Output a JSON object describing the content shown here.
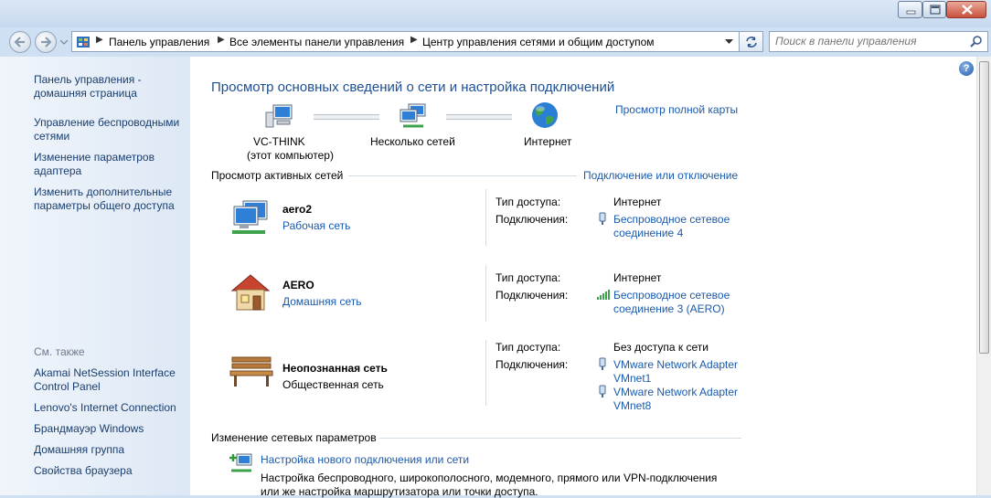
{
  "address": {
    "seg1": "Панель управления",
    "seg2": "Все элементы панели управления",
    "seg3": "Центр управления сетями и общим доступом",
    "separator": "▶"
  },
  "search": {
    "placeholder": "Поиск в панели управления"
  },
  "help_label": "?",
  "sidebar": {
    "items": [
      {
        "label": "Панель управления -\nдомашняя страница"
      },
      {
        "label": "Управление беспроводными\nсетями"
      },
      {
        "label": "Изменение параметров\nадаптера"
      },
      {
        "label": "Изменить дополнительные\nпараметры общего доступа"
      }
    ],
    "see_also": "См. также",
    "see_also_items": [
      {
        "label": "Akamai NetSession Interface\nControl Panel"
      },
      {
        "label": "Lenovo's Internet Connection"
      },
      {
        "label": "Брандмауэр Windows"
      },
      {
        "label": "Домашняя группа"
      },
      {
        "label": "Свойства браузера"
      }
    ]
  },
  "main": {
    "title": "Просмотр основных сведений о сети и настройка подключений",
    "full_map_link": "Просмотр полной карты",
    "map": {
      "computer": "VC-THINK",
      "computer_sub": "(этот компьютер)",
      "networks": "Несколько сетей",
      "internet": "Интернет"
    },
    "active_header": "Просмотр активных сетей",
    "connect_link": "Подключение или отключение",
    "labels": {
      "access": "Тип доступа:",
      "connections": "Подключения:"
    },
    "networks": [
      {
        "name": "aero2",
        "type": "Рабочая сеть",
        "access": "Интернет",
        "connection": "Беспроводное сетевое",
        "connection2": "соединение 4"
      },
      {
        "name": "AERO",
        "type": "Домашняя сеть",
        "access": "Интернет",
        "connection": "Беспроводное сетевое",
        "connection2": "соединение 3 (AERO)"
      },
      {
        "name": "Неопознанная сеть",
        "type": "Общественная сеть",
        "access": "Без доступа к сети",
        "connection": "VMware Network Adapter",
        "connection2": "VMnet1",
        "connection3": "VMware Network Adapter",
        "connection4": "VMnet8"
      }
    ],
    "change_header": "Изменение сетевых параметров",
    "tasks": [
      {
        "link": "Настройка нового подключения или сети",
        "desc": "Настройка беспроводного, широкополосного, модемного, прямого или VPN-подключения",
        "desc2": "или же настройка маршрутизатора или точки доступа."
      }
    ]
  }
}
